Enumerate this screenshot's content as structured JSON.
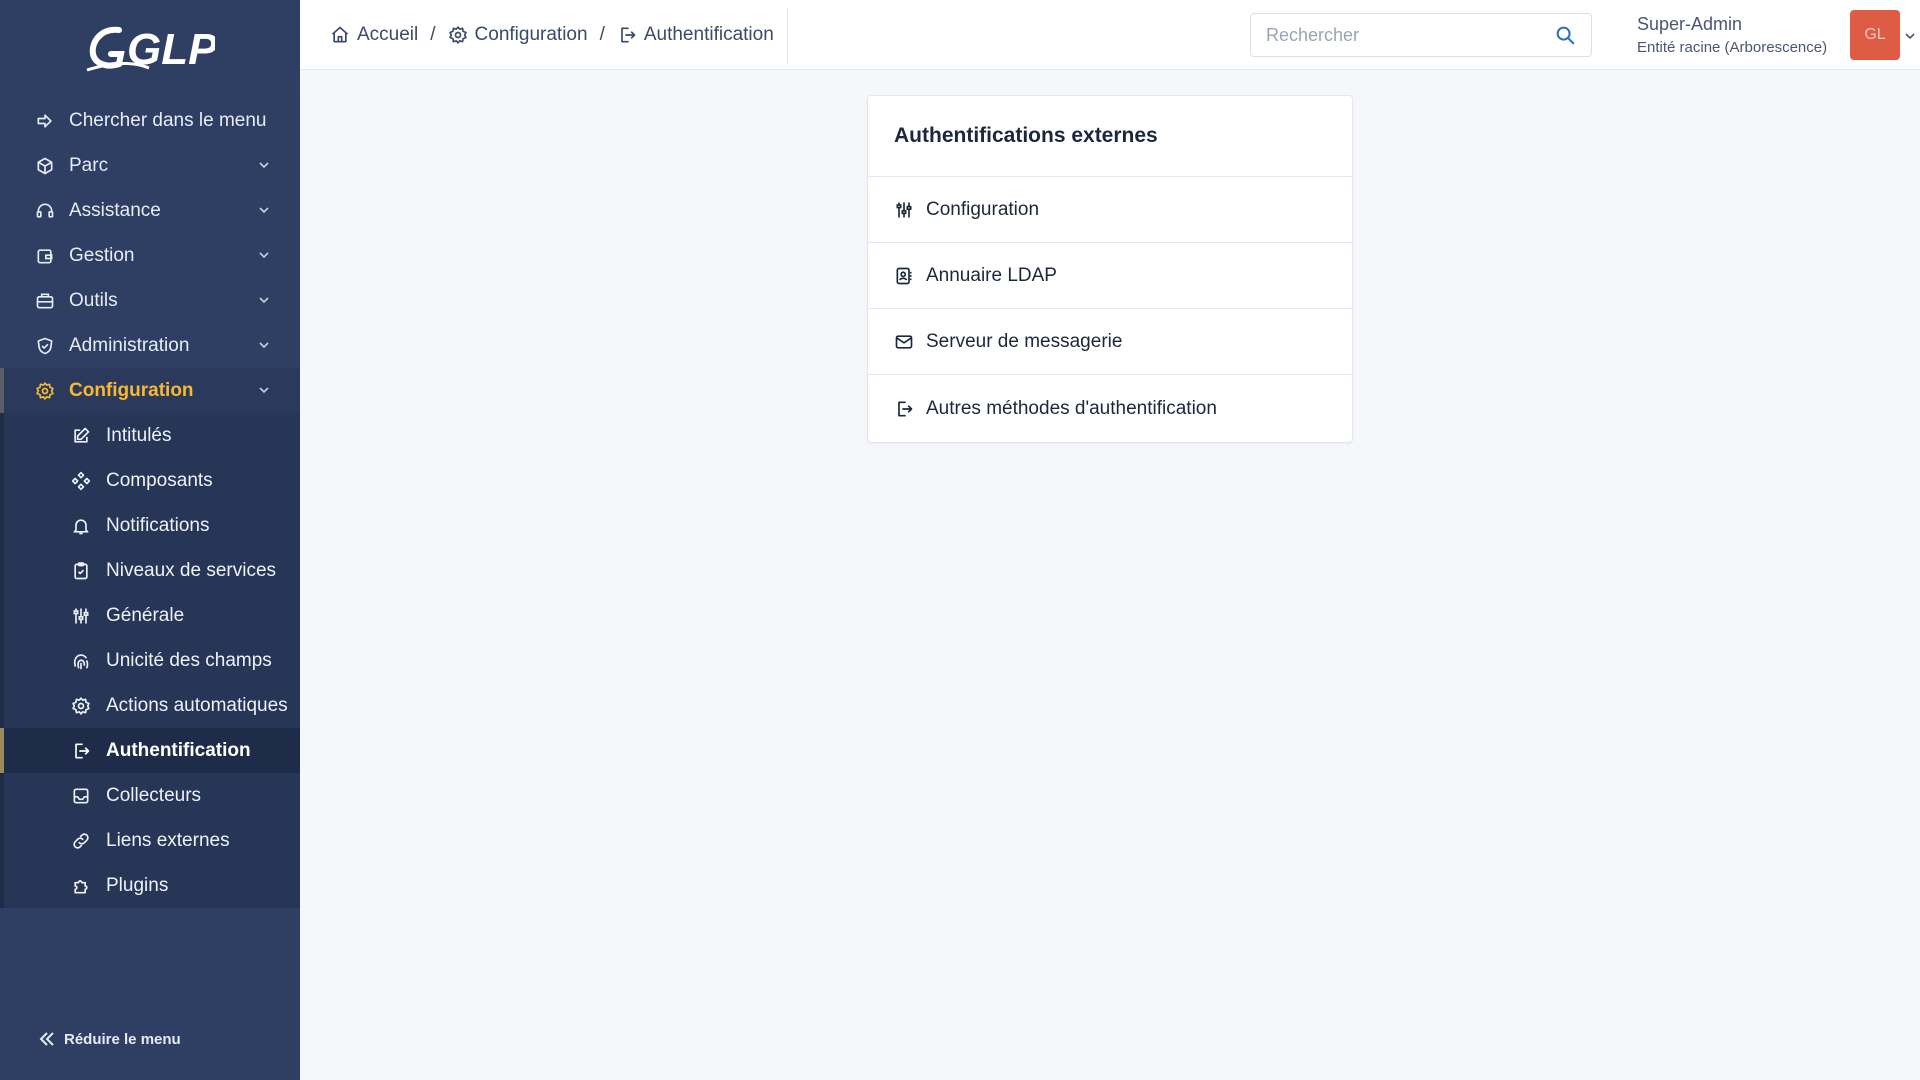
{
  "app": {
    "logo_text": "GLPI"
  },
  "sidebar": {
    "search_label": "Chercher dans le menu",
    "items": [
      {
        "label": "Parc",
        "icon": "box-icon"
      },
      {
        "label": "Assistance",
        "icon": "headset-icon"
      },
      {
        "label": "Gestion",
        "icon": "wallet-icon"
      },
      {
        "label": "Outils",
        "icon": "briefcase-icon"
      },
      {
        "label": "Administration",
        "icon": "shield-icon"
      },
      {
        "label": "Configuration",
        "icon": "gear-icon",
        "active": true
      }
    ],
    "submenu": [
      {
        "label": "Intitulés",
        "icon": "edit-icon"
      },
      {
        "label": "Composants",
        "icon": "components-icon"
      },
      {
        "label": "Notifications",
        "icon": "bell-icon"
      },
      {
        "label": "Niveaux de services",
        "icon": "clipboard-check-icon"
      },
      {
        "label": "Générale",
        "icon": "adjustments-icon"
      },
      {
        "label": "Unicité des champs",
        "icon": "fingerprint-icon"
      },
      {
        "label": "Actions automatiques",
        "icon": "gear-icon"
      },
      {
        "label": "Authentification",
        "icon": "login-icon",
        "active": true
      },
      {
        "label": "Collecteurs",
        "icon": "inbox-icon"
      },
      {
        "label": "Liens externes",
        "icon": "link-icon"
      },
      {
        "label": "Plugins",
        "icon": "puzzle-icon"
      }
    ],
    "collapse_label": "Réduire le menu"
  },
  "header": {
    "breadcrumb": [
      "Accueil",
      "Configuration",
      "Authentification"
    ],
    "search_placeholder": "Rechercher",
    "user_name": "Super-Admin",
    "user_entity": "Entité racine (Arborescence)",
    "avatar_initials": "GL"
  },
  "card": {
    "title": "Authentifications externes",
    "rows": [
      {
        "label": "Configuration",
        "icon": "adjustments-icon"
      },
      {
        "label": "Annuaire LDAP",
        "icon": "address-book-icon"
      },
      {
        "label": "Serveur de messagerie",
        "icon": "mail-icon"
      },
      {
        "label": "Autres méthodes d'authentification",
        "icon": "login-icon"
      }
    ]
  },
  "colors": {
    "sidebar_bg": "#2f3f64",
    "active_menu": "#f7b833",
    "avatar_bg": "#df5c44"
  }
}
